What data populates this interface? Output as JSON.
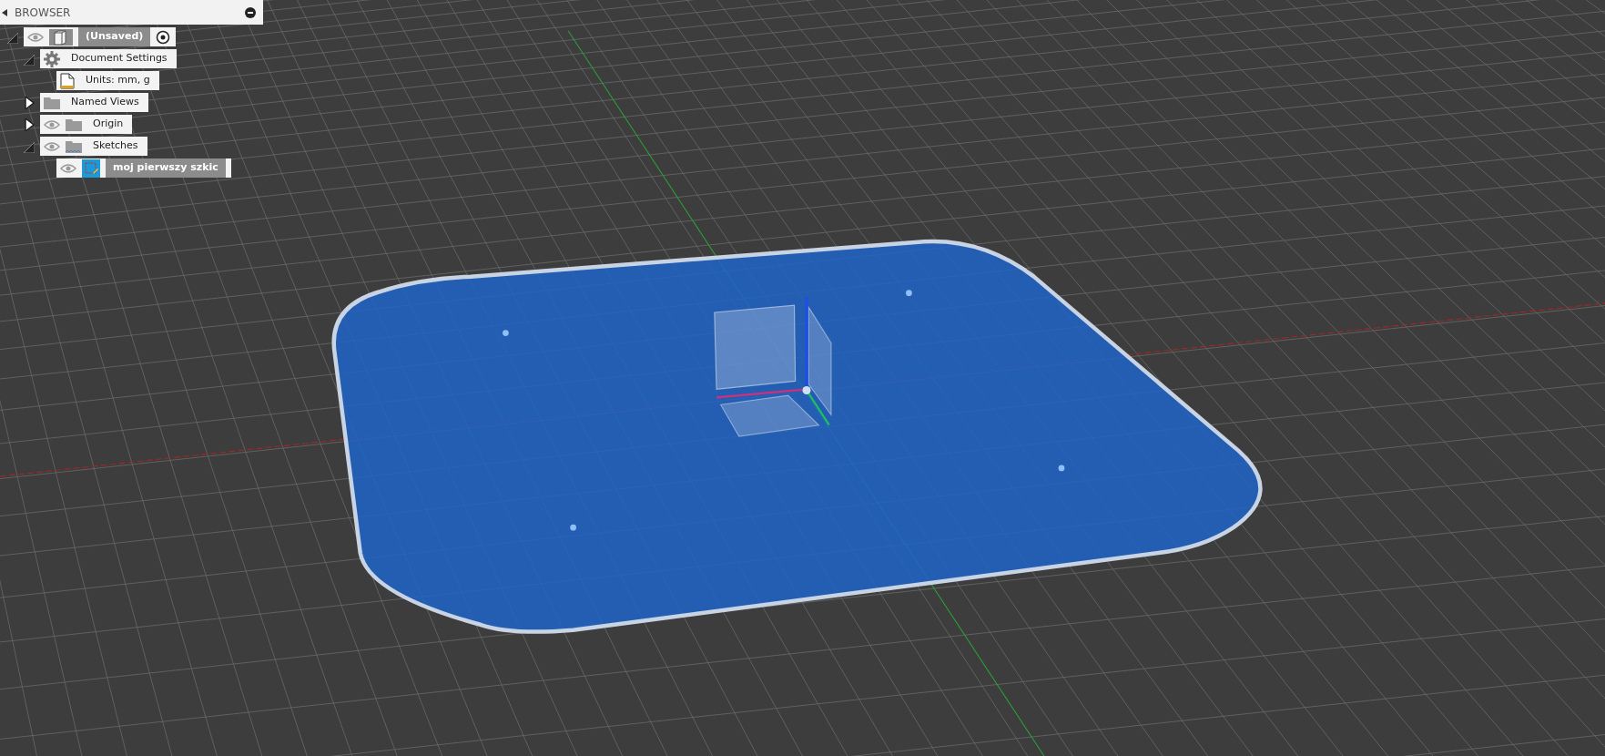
{
  "browser": {
    "title": "BROWSER",
    "tree": [
      {
        "label": "(Unsaved)",
        "kind": "component",
        "expanded": true,
        "eye": true,
        "selected": true,
        "children": [
          {
            "label": "Document Settings",
            "kind": "settings",
            "expanded": true,
            "eye": false,
            "selected": false,
            "children": [
              {
                "label": "Units: mm, g",
                "kind": "units",
                "eye": false,
                "selected": false
              }
            ]
          },
          {
            "label": "Named Views",
            "kind": "folder",
            "expanded": false,
            "eye": false,
            "selected": false
          },
          {
            "label": "Origin",
            "kind": "folder",
            "expanded": false,
            "eye": true,
            "selected": false
          },
          {
            "label": "Sketches",
            "kind": "sketches",
            "expanded": true,
            "eye": true,
            "selected": false,
            "children": [
              {
                "label": "moj pierwszy szkic",
                "kind": "sketch",
                "eye": true,
                "selected": true
              }
            ]
          }
        ]
      }
    ]
  }
}
